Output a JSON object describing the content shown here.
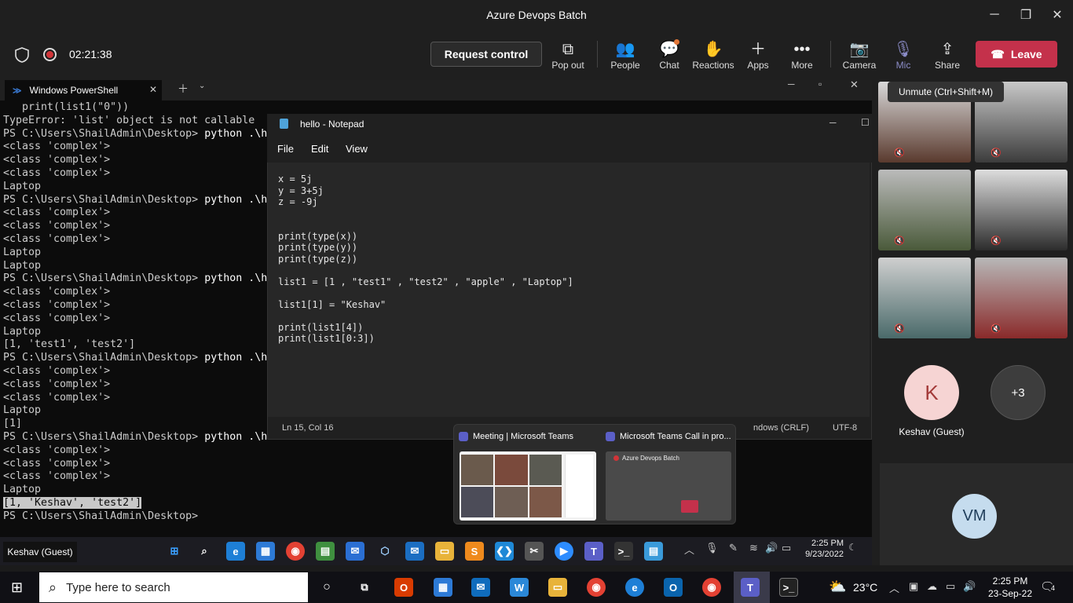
{
  "window": {
    "title": "Azure Devops Batch"
  },
  "toolbar": {
    "timer": "02:21:38",
    "request_control": "Request control",
    "items": [
      {
        "label": "Pop out"
      },
      {
        "label": "People"
      },
      {
        "label": "Chat"
      },
      {
        "label": "Reactions"
      },
      {
        "label": "Apps"
      },
      {
        "label": "More"
      },
      {
        "label": "Camera"
      },
      {
        "label": "Mic"
      },
      {
        "label": "Share"
      }
    ],
    "leave": "Leave"
  },
  "powershell": {
    "tab_title": "Windows PowerShell",
    "lines": [
      "   print(list1(\"0\"))",
      "TypeError: 'list' object is not callable",
      "PS C:\\Users\\ShailAdmin\\Desktop> python .\\h",
      "<class 'complex'>",
      "<class 'complex'>",
      "<class 'complex'>",
      "Laptop",
      "PS C:\\Users\\ShailAdmin\\Desktop> python .\\h",
      "<class 'complex'>",
      "<class 'complex'>",
      "<class 'complex'>",
      "Laptop",
      "Laptop",
      "PS C:\\Users\\ShailAdmin\\Desktop> python .\\h",
      "<class 'complex'>",
      "<class 'complex'>",
      "<class 'complex'>",
      "Laptop",
      "[1, 'test1', 'test2']",
      "PS C:\\Users\\ShailAdmin\\Desktop> python .\\h",
      "<class 'complex'>",
      "<class 'complex'>",
      "<class 'complex'>",
      "Laptop",
      "[1]",
      "PS C:\\Users\\ShailAdmin\\Desktop> python .\\hello.py",
      "<class 'complex'>",
      "<class 'complex'>",
      "<class 'complex'>",
      "Laptop",
      "[1, 'Keshav', 'test2']",
      "PS C:\\Users\\ShailAdmin\\Desktop>"
    ]
  },
  "notepad": {
    "title": "hello - Notepad",
    "menu": [
      "File",
      "Edit",
      "View"
    ],
    "code": "x = 5j\ny = 3+5j\nz = -9j\n\n\nprint(type(x))\nprint(type(y))\nprint(type(z))\n\nlist1 = [1 , \"test1\" , \"test2\" , \"apple\" , \"Laptop\"]\n\nlist1[1] = \"Keshav\"\n\nprint(list1[4])\nprint(list1[0:3])",
    "status_pos": "Ln 15, Col 16",
    "status_eol": "ndows (CRLF)",
    "status_enc": "UTF-8"
  },
  "preview": {
    "left_title": "Meeting | Microsoft Teams",
    "right_title": "Microsoft Teams Call in pro...",
    "right_inner": "Azure Devops Batch"
  },
  "shared_taskbar": {
    "presenter": "Keshav (Guest)",
    "time": "2:25 PM",
    "date": "9/23/2022"
  },
  "participants": {
    "tooltip": "Unmute (Ctrl+Shift+M)",
    "guest_initial": "K",
    "guest_name": "Keshav (Guest)",
    "overflow": "+3",
    "vm_initials": "VM"
  },
  "taskbar": {
    "search_placeholder": "Type here to search",
    "temperature": "23°C",
    "time": "2:25 PM",
    "date": "23-Sep-22",
    "notifications": "4"
  }
}
